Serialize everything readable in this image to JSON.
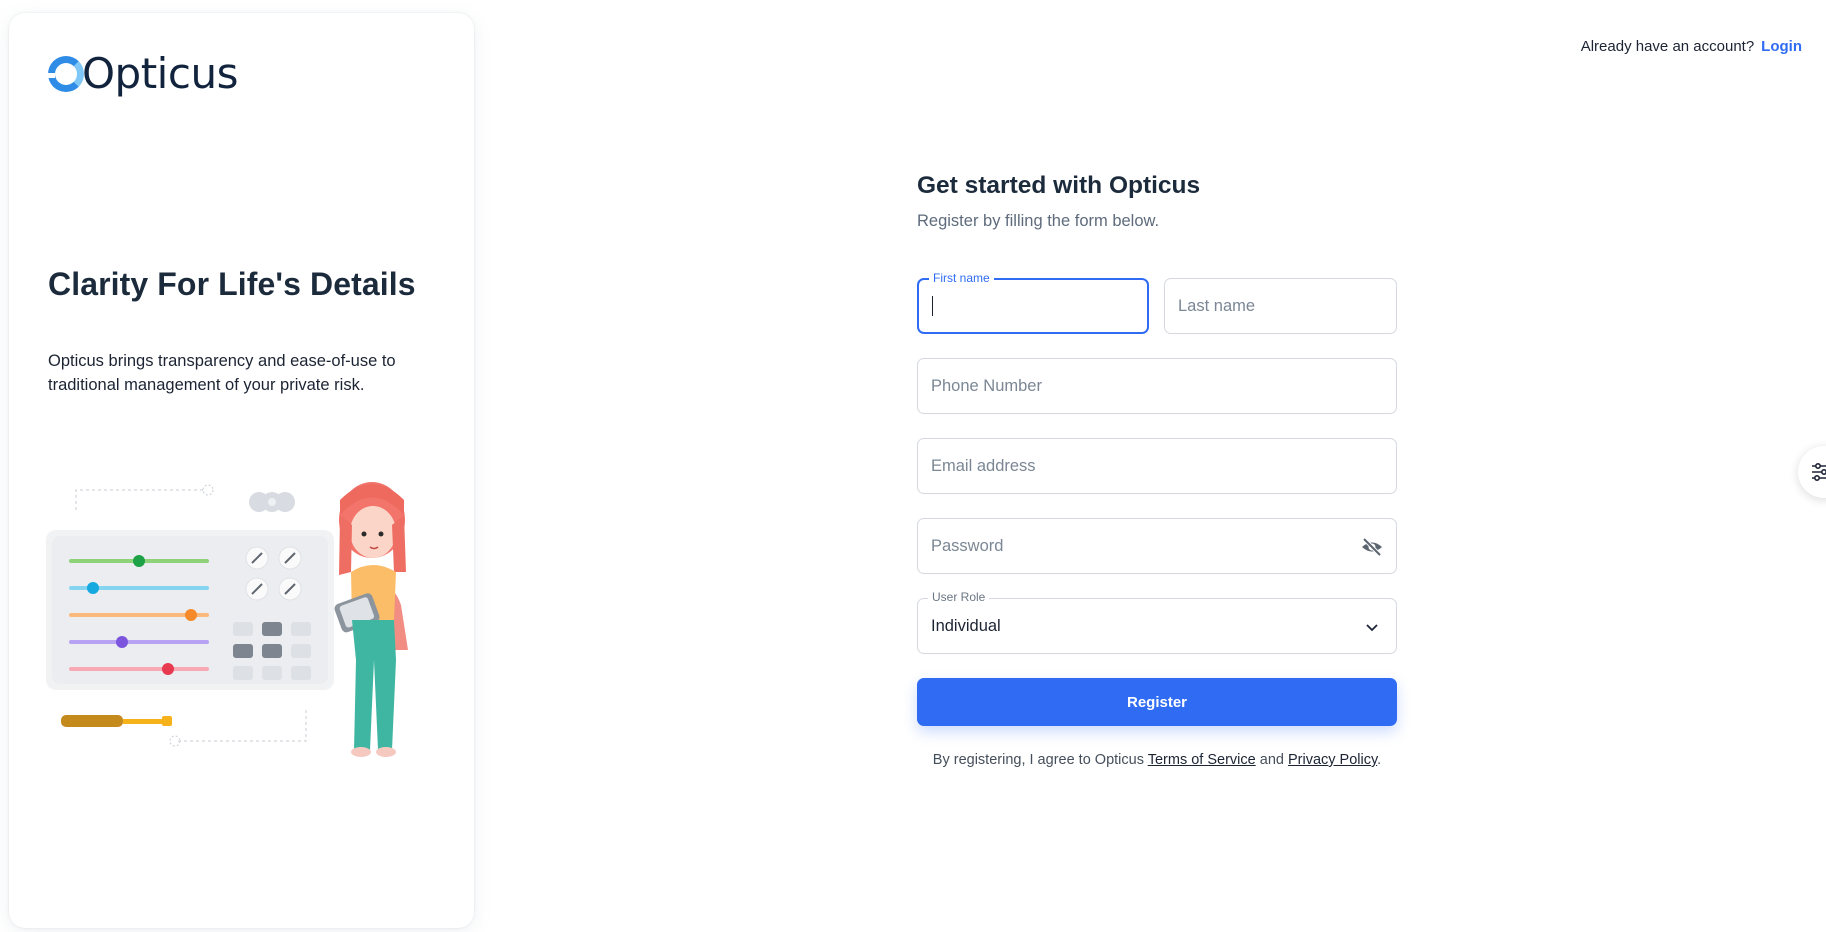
{
  "brand": {
    "name": "Opticus"
  },
  "left_panel": {
    "title": "Clarity For Life's Details",
    "text": "Opticus brings transparency and ease-of-use to traditional management of your private risk."
  },
  "topbar": {
    "question": "Already have an account?",
    "login_label": "Login"
  },
  "form": {
    "title": "Get started with Opticus",
    "subtitle": "Register by filling the form below.",
    "first_name": {
      "label": "First name",
      "value": ""
    },
    "last_name": {
      "placeholder": "Last name"
    },
    "phone": {
      "placeholder": "Phone Number"
    },
    "email": {
      "placeholder": "Email address"
    },
    "password": {
      "placeholder": "Password",
      "icon": "eye-off-icon"
    },
    "user_role": {
      "label": "User Role",
      "value": "Individual",
      "icon": "chevron-down-icon"
    },
    "register_label": "Register",
    "terms": {
      "prefix": "By registering, I agree to Opticus",
      "tos": "Terms of Service",
      "and": "and",
      "privacy": "Privacy Policy",
      "suffix": "."
    }
  },
  "colors": {
    "accent": "#2f6cf3",
    "heading": "#1c2b3c",
    "muted": "#5e6b7c"
  }
}
